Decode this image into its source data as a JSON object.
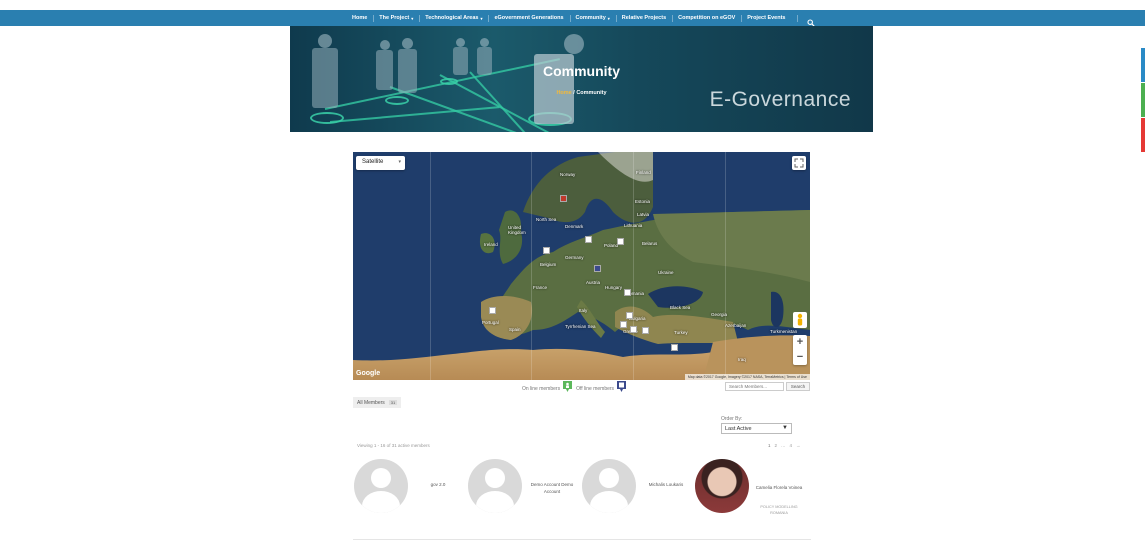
{
  "nav": {
    "items": [
      {
        "label": "Home",
        "dropdown": false
      },
      {
        "label": "The Project",
        "dropdown": true
      },
      {
        "label": "Technological Areas",
        "dropdown": true
      },
      {
        "label": "eGovernment Generations",
        "dropdown": false
      },
      {
        "label": "Community",
        "dropdown": true
      },
      {
        "label": "Relative Projects",
        "dropdown": false
      },
      {
        "label": "Competition on eGOV",
        "dropdown": false
      },
      {
        "label": "Project Events",
        "dropdown": false
      }
    ],
    "caret": "▾",
    "search_icon": "search-icon"
  },
  "banner": {
    "title": "Community",
    "breadcrumb_home": "Home",
    "breadcrumb_separator": " / ",
    "breadcrumb_current": "Community",
    "brand": "E-Governance",
    "line_color": "#35c9a2"
  },
  "map": {
    "type_label": "Satellite",
    "type_dropdown": "▾",
    "zoom_in": "+",
    "zoom_out": "−",
    "google": "Google",
    "attribution": "Map data ©2017 Google, Imagery ©2017 NASA, TerraMetrics | Terms of Use",
    "labels": {
      "finland": "Finland",
      "norway": "Norway",
      "estonia": "Estonia",
      "latvia": "Latvia",
      "lithuania": "Lithuania",
      "north_sea": "North Sea",
      "denmark": "Denmark",
      "uk": "United\nKingdom",
      "ireland": "Ireland",
      "belarus": "Belarus",
      "poland": "Poland",
      "germany": "Germany",
      "belgium": "Belgium",
      "ukraine": "Ukraine",
      "france": "France",
      "austria": "Austria",
      "hungary": "Hungary",
      "romania": "Romania",
      "black_sea": "Black Sea",
      "georgia": "Georgia",
      "azerbaijan": "Azerbaijan",
      "turkmenistan": "Turkmenistan",
      "portugal": "Portugal",
      "spain": "Spain",
      "italy": "Italy",
      "bulgaria": "Bulgaria",
      "greece": "Greece",
      "turkey": "Turkey",
      "tyrrhenian": "Tyrrhenian Sea",
      "iraq": "Iraq"
    }
  },
  "legend": {
    "online": "On line members",
    "offline": "Off line members",
    "online_color": "#5cb85c",
    "offline_color": "#3b4a8c"
  },
  "search": {
    "placeholder": "Search Members...",
    "button": "Search"
  },
  "tabs": {
    "all_members": "All Members",
    "count": "31"
  },
  "order": {
    "label": "Order By:",
    "selected": "Last Active",
    "arrow": "▼"
  },
  "listing": {
    "viewing": "Viewing 1 - 16 of 31 active members",
    "pages": [
      "1",
      "2",
      "…",
      "4",
      "→"
    ]
  },
  "members": [
    {
      "name": "gov 2.0",
      "meta": ""
    },
    {
      "name": "Demo Account Demo Account",
      "meta": ""
    },
    {
      "name": "Michalis Loukaris",
      "meta": ""
    },
    {
      "name": "Camelia Florela Voinea",
      "meta": "POLICY MODELLING ROMANIA"
    }
  ],
  "side_tabs": [
    "#2a8ac6",
    "#4caf50",
    "#e53935"
  ]
}
